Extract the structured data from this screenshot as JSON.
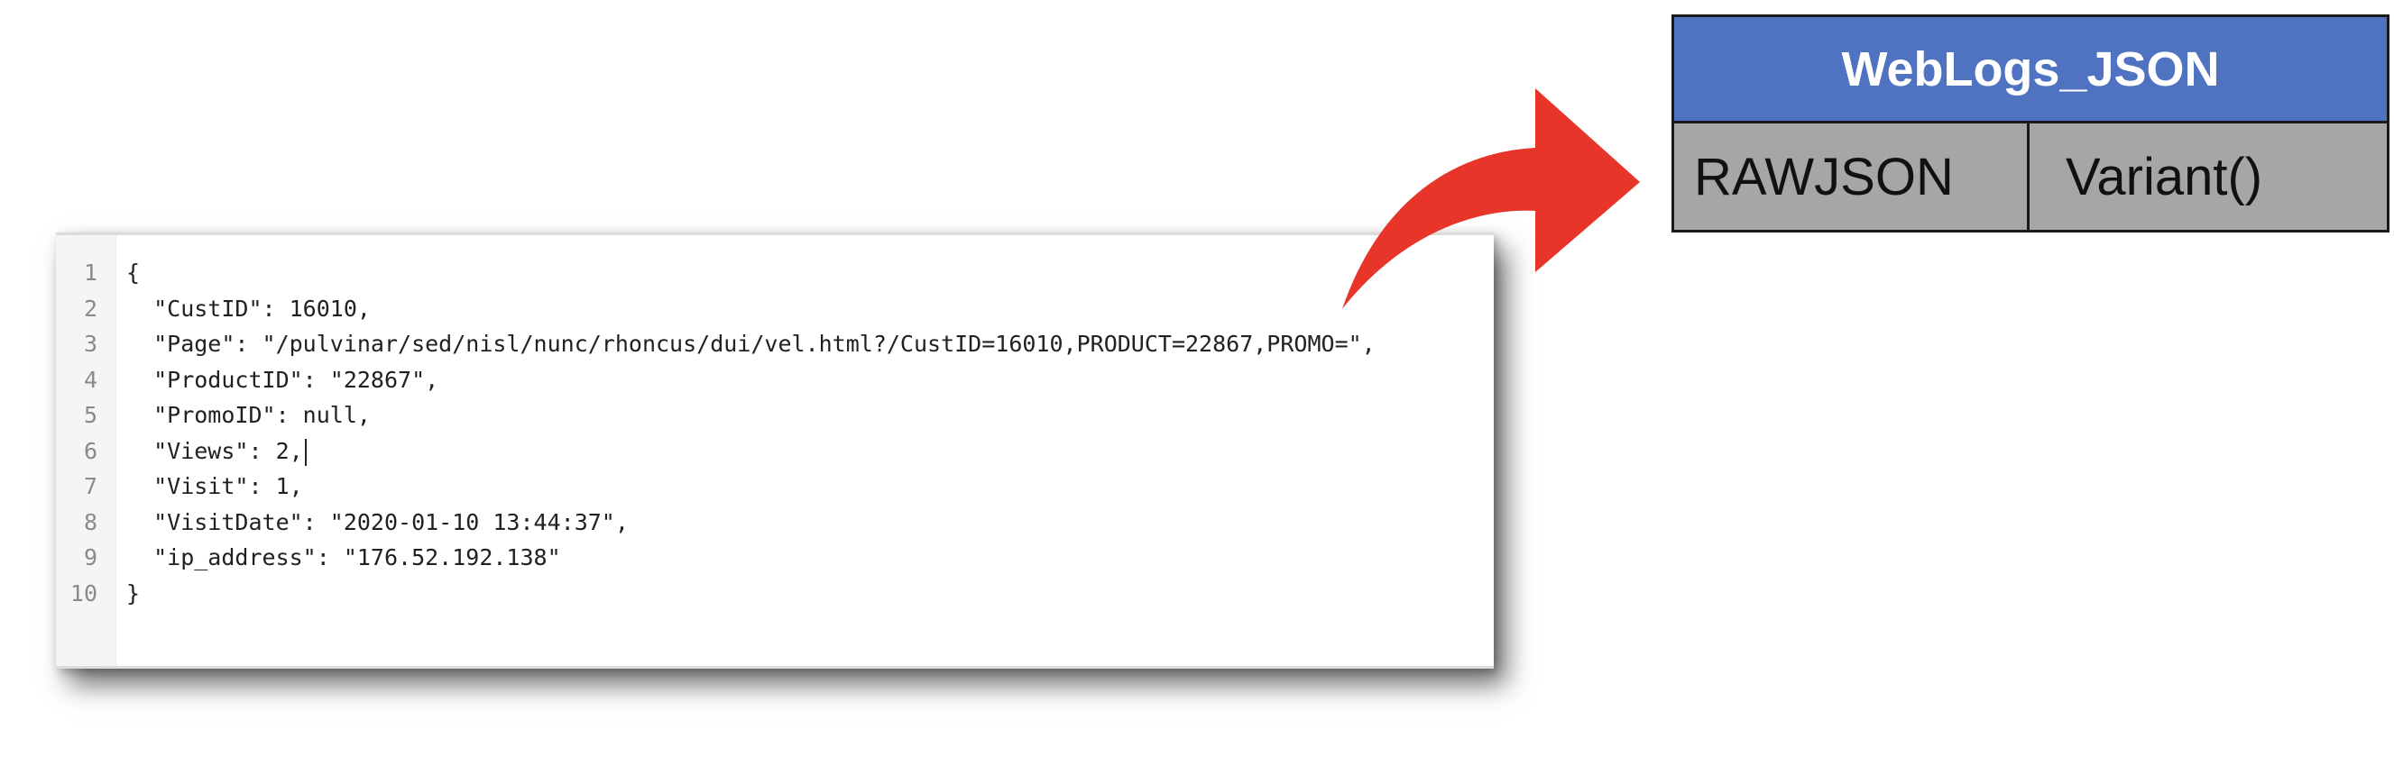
{
  "editor": {
    "lines": [
      {
        "num": "1",
        "text": "{"
      },
      {
        "num": "2",
        "text": "  \"CustID\": 16010,"
      },
      {
        "num": "3",
        "text": "  \"Page\": \"/pulvinar/sed/nisl/nunc/rhoncus/dui/vel.html?/CustID=16010,PRODUCT=22867,PROMO=\","
      },
      {
        "num": "4",
        "text": "  \"ProductID\": \"22867\","
      },
      {
        "num": "5",
        "text": "  \"PromoID\": null,"
      },
      {
        "num": "6",
        "text": "  \"Views\": 2,"
      },
      {
        "num": "7",
        "text": "  \"Visit\": 1,"
      },
      {
        "num": "8",
        "text": "  \"VisitDate\": \"2020-01-10 13:44:37\","
      },
      {
        "num": "9",
        "text": "  \"ip_address\": \"176.52.192.138\""
      },
      {
        "num": "10",
        "text": "}"
      }
    ],
    "caret_line": 6
  },
  "arrow": {
    "color": "#e8352a",
    "icon": "curved-arrow-right-icon"
  },
  "table": {
    "title": "WebLogs_JSON",
    "header_color": "#4f73c0",
    "row_color": "#a6a6a6",
    "column_name": "RAWJSON",
    "column_type": "Variant()"
  }
}
